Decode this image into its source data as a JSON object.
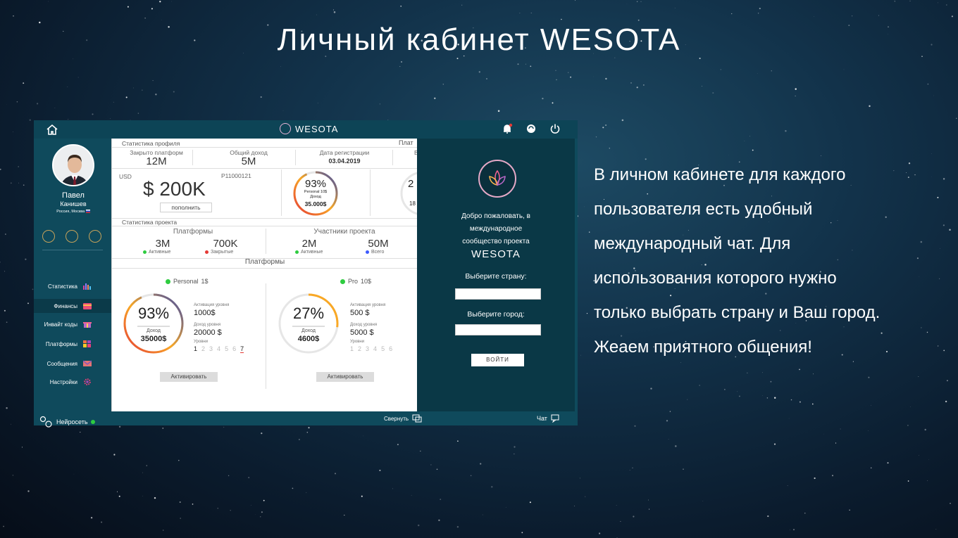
{
  "page": {
    "title": "Личный кабинет WESOTA",
    "description_lines": [
      "В личном кабинете для каждого",
      "пользователя есть удобный",
      "международный чат. Для",
      "использования которого нужно",
      "только выбрать страну и Ваш город.",
      "Жеаем приятного общения!"
    ]
  },
  "app": {
    "brand": "WESOTA",
    "user": {
      "first_name": "Павел",
      "last_name": "Канишев",
      "location": "Россия, Москва"
    },
    "nav": [
      {
        "label": "Статистика",
        "icon": "bar-chart-icon"
      },
      {
        "label": "Финансы",
        "icon": "wallet-icon",
        "active": true
      },
      {
        "label": "Инвайт коды",
        "icon": "gift-icon"
      },
      {
        "label": "Платформы",
        "icon": "grid-icon"
      },
      {
        "label": "Сообщения",
        "icon": "envelope-icon"
      },
      {
        "label": "Настройки",
        "icon": "gear-icon"
      }
    ],
    "neuro_label": "Нейросеть",
    "profile": {
      "section_label": "Статистика профиля",
      "section_label_right": "Плат",
      "closed_platforms_label": "Закрыто платформ",
      "closed_platforms_value": "12M",
      "total_income_label": "Общий доход",
      "total_income_value": "5M",
      "reg_date_label": "Дата регистрации",
      "reg_date_value": "03.04.2019",
      "reg_right_fragment": "В",
      "currency": "USD",
      "account_id": "P11000121",
      "balance": "$ 200K",
      "topup_label": "пополнить",
      "ring_percent": "93%",
      "ring_sub": "Personal 10$",
      "ring_income_label": "Доход",
      "ring_income": "35.000$",
      "right_ring_fragment": "2",
      "right_ring_sub": "18"
    },
    "project": {
      "section_label": "Статистика проекта",
      "platforms_label": "Платформы",
      "platforms_active": "3M",
      "platforms_active_label": "Активные",
      "platforms_closed": "700K",
      "platforms_closed_label": "Закрытые",
      "members_label": "Участники проекта",
      "members_active": "2M",
      "members_active_label": "Активные",
      "members_total": "50M",
      "members_total_label": "Всего"
    },
    "platforms": {
      "section_label": "Платформы",
      "activation_label": "Активация уровня",
      "level_income_label": "Доход уровня",
      "levels_label": "Уровни",
      "income_label": "Доход",
      "activate_label": "Активировать",
      "cards": [
        {
          "name": "Personal",
          "price": "1$",
          "percent": "93%",
          "progress": 0.93,
          "income": "35000$",
          "activation": "1000$",
          "level_income": "20000 $",
          "levels": [
            "1",
            "2",
            "3",
            "4",
            "5",
            "6",
            "7"
          ],
          "current_level": "7"
        },
        {
          "name": "Pro",
          "price": "10$",
          "percent": "27%",
          "progress": 0.27,
          "income": "4600$",
          "activation": "500 $",
          "level_income": "5000 $",
          "levels": [
            "1",
            "2",
            "3",
            "4",
            "5",
            "6"
          ],
          "current_level": ""
        }
      ]
    },
    "chat": {
      "welcome_line1": "Добро пожаловать, в",
      "welcome_line2": "международное",
      "welcome_line3": "сообщество проекта",
      "welcome_brand": "WESOTA",
      "country_label": "Выберите страну:",
      "city_label": "Выберите город:",
      "login_label": "ВОЙТИ"
    },
    "bottom": {
      "collapse_label": "Свернуть",
      "chat_label": "Чат"
    },
    "colors": {
      "accent_green": "#2ecc40",
      "accent_red": "#e53935",
      "accent_blue": "#3d5afe",
      "frame": "#0f4a5c"
    }
  }
}
